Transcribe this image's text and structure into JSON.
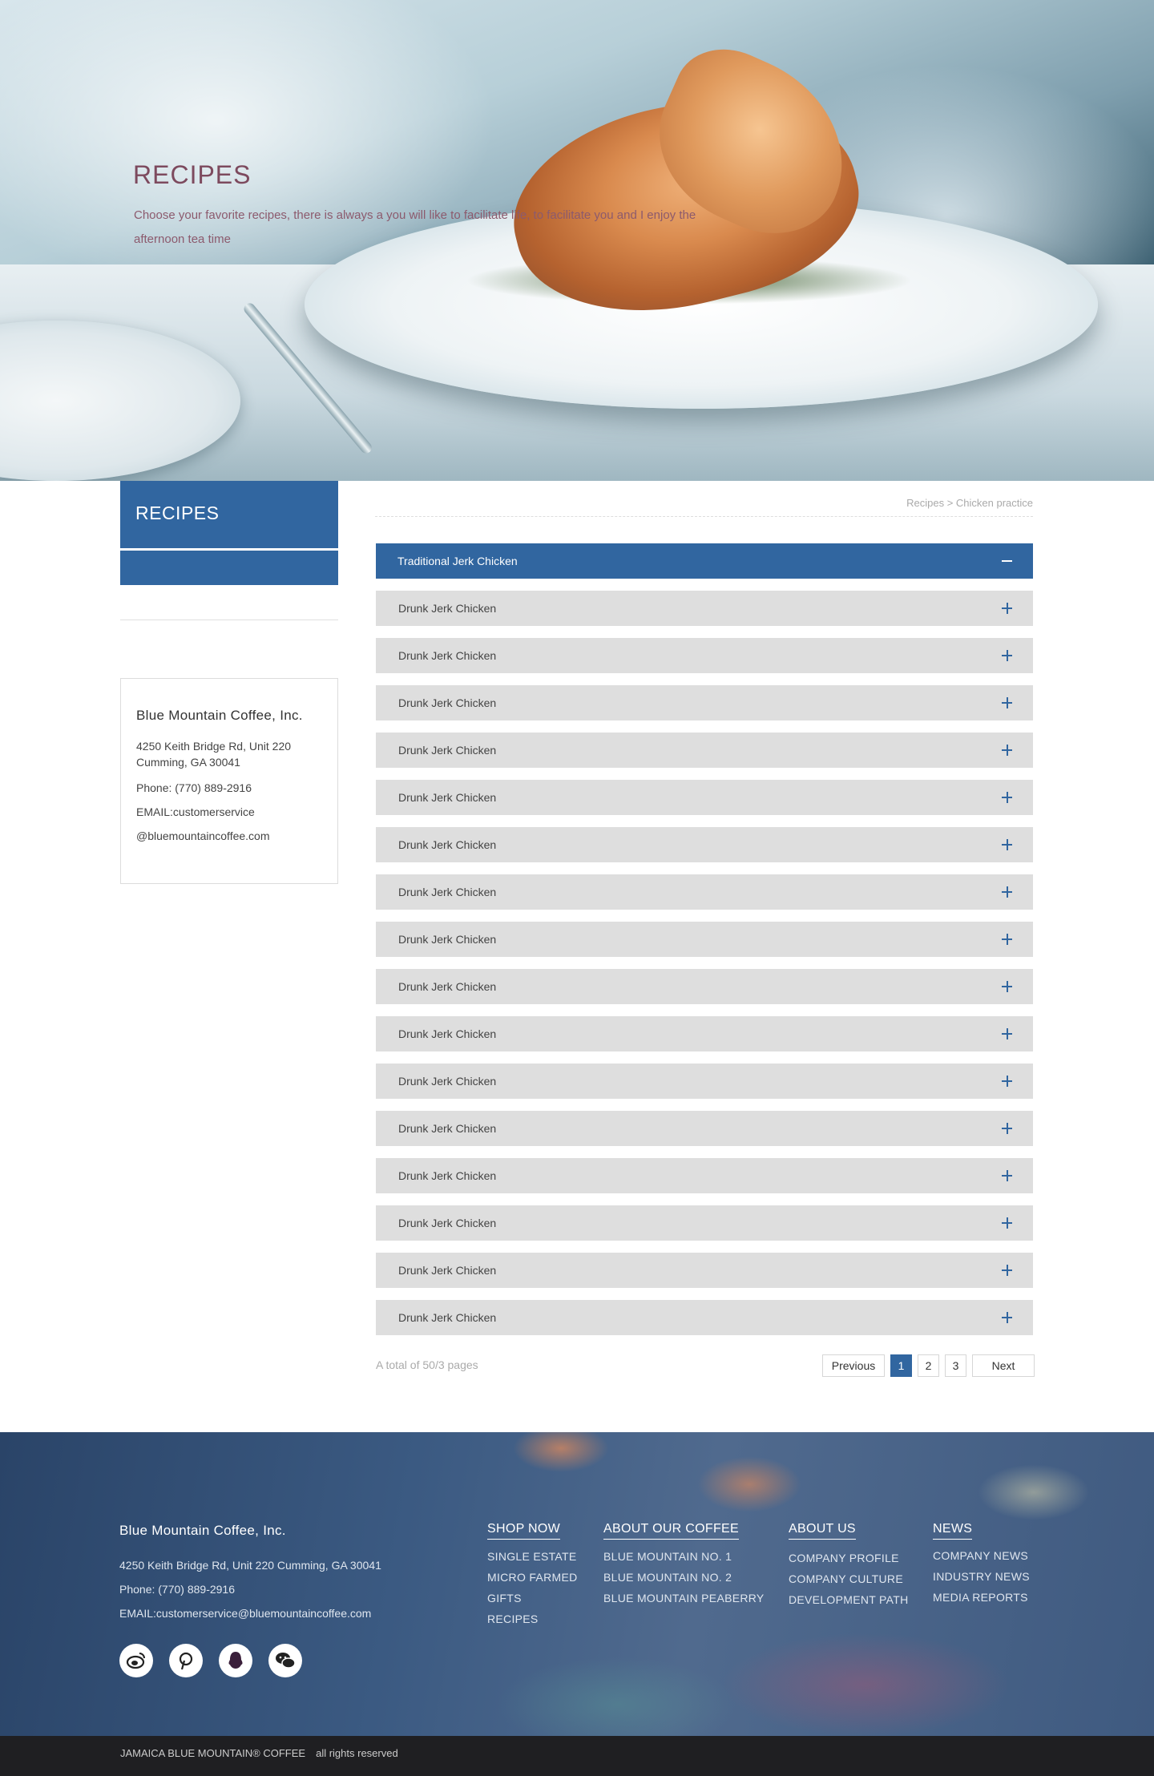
{
  "hero": {
    "title": "RECIPES",
    "description": "Choose your favorite recipes, there is always a you will like to facilitate life, to facilitate you and I enjoy the afternoon tea time"
  },
  "sidebar": {
    "title": "RECIPES",
    "contact": {
      "company": "Blue Mountain Coffee, Inc.",
      "address_line1": "4250 Keith Bridge Rd, Unit 220",
      "address_line2": " Cumming, GA 30041",
      "phone": "Phone: (770) 889-2916",
      "email_line1": "EMAIL:customerservice",
      "email_line2": "@bluemountaincoffee.com"
    }
  },
  "breadcrumb": "Recipes > Chicken practice",
  "accordion": {
    "items": [
      {
        "label": "Traditional Jerk Chicken",
        "expanded": true
      },
      {
        "label": "Drunk Jerk Chicken",
        "expanded": false
      },
      {
        "label": "Drunk Jerk Chicken",
        "expanded": false
      },
      {
        "label": "Drunk Jerk Chicken",
        "expanded": false
      },
      {
        "label": "Drunk Jerk Chicken",
        "expanded": false
      },
      {
        "label": "Drunk Jerk Chicken",
        "expanded": false
      },
      {
        "label": "Drunk Jerk Chicken",
        "expanded": false
      },
      {
        "label": "Drunk Jerk Chicken",
        "expanded": false
      },
      {
        "label": "Drunk Jerk Chicken",
        "expanded": false
      },
      {
        "label": "Drunk Jerk Chicken",
        "expanded": false
      },
      {
        "label": "Drunk Jerk Chicken",
        "expanded": false
      },
      {
        "label": "Drunk Jerk Chicken",
        "expanded": false
      },
      {
        "label": "Drunk Jerk Chicken",
        "expanded": false
      },
      {
        "label": "Drunk Jerk Chicken",
        "expanded": false
      },
      {
        "label": "Drunk Jerk Chicken",
        "expanded": false
      },
      {
        "label": "Drunk Jerk Chicken",
        "expanded": false
      },
      {
        "label": "Drunk Jerk Chicken",
        "expanded": false
      }
    ]
  },
  "pagination": {
    "total_text": "A total of 50/3 pages",
    "previous": "Previous",
    "next": "Next",
    "pages": [
      "1",
      "2",
      "3"
    ],
    "current": "1"
  },
  "footer": {
    "company": "Blue Mountain Coffee, Inc.",
    "address": "4250 Keith Bridge Rd, Unit 220 Cumming, GA 30041",
    "phone": "Phone: (770) 889-2916",
    "email": "EMAIL:customerservice@bluemountaincoffee.com",
    "social_icons": [
      "weibo-icon",
      "pinterest-icon",
      "qq-icon",
      "wechat-icon"
    ],
    "columns": [
      {
        "heading": "SHOP NOW",
        "items": [
          "SINGLE ESTATE",
          "MICRO FARMED",
          "GIFTS",
          "RECIPES"
        ]
      },
      {
        "heading": "ABOUT OUR COFFEE",
        "items": [
          "BLUE MOUNTAIN NO. 1",
          "BLUE MOUNTAIN NO. 2",
          "BLUE MOUNTAIN PEABERRY"
        ]
      },
      {
        "heading": "ABOUT US",
        "items": [
          "COMPANY PROFILE",
          "COMPANY CULTURE",
          "DEVELOPMENT PATH"
        ]
      },
      {
        "heading": "NEWS",
        "items": [
          "COMPANY NEWS",
          "INDUSTRY NEWS",
          "MEDIA REPORTS"
        ]
      }
    ]
  },
  "bottom_bar": {
    "brand": "JAMAICA BLUE MOUNTAIN® COFFEE",
    "rights": "all rights reserved"
  },
  "colors": {
    "accent": "#3166a0",
    "hero_text": "#7d4a5e",
    "accordion_bg": "#dedede",
    "bottom_bar": "#1f1f22"
  }
}
